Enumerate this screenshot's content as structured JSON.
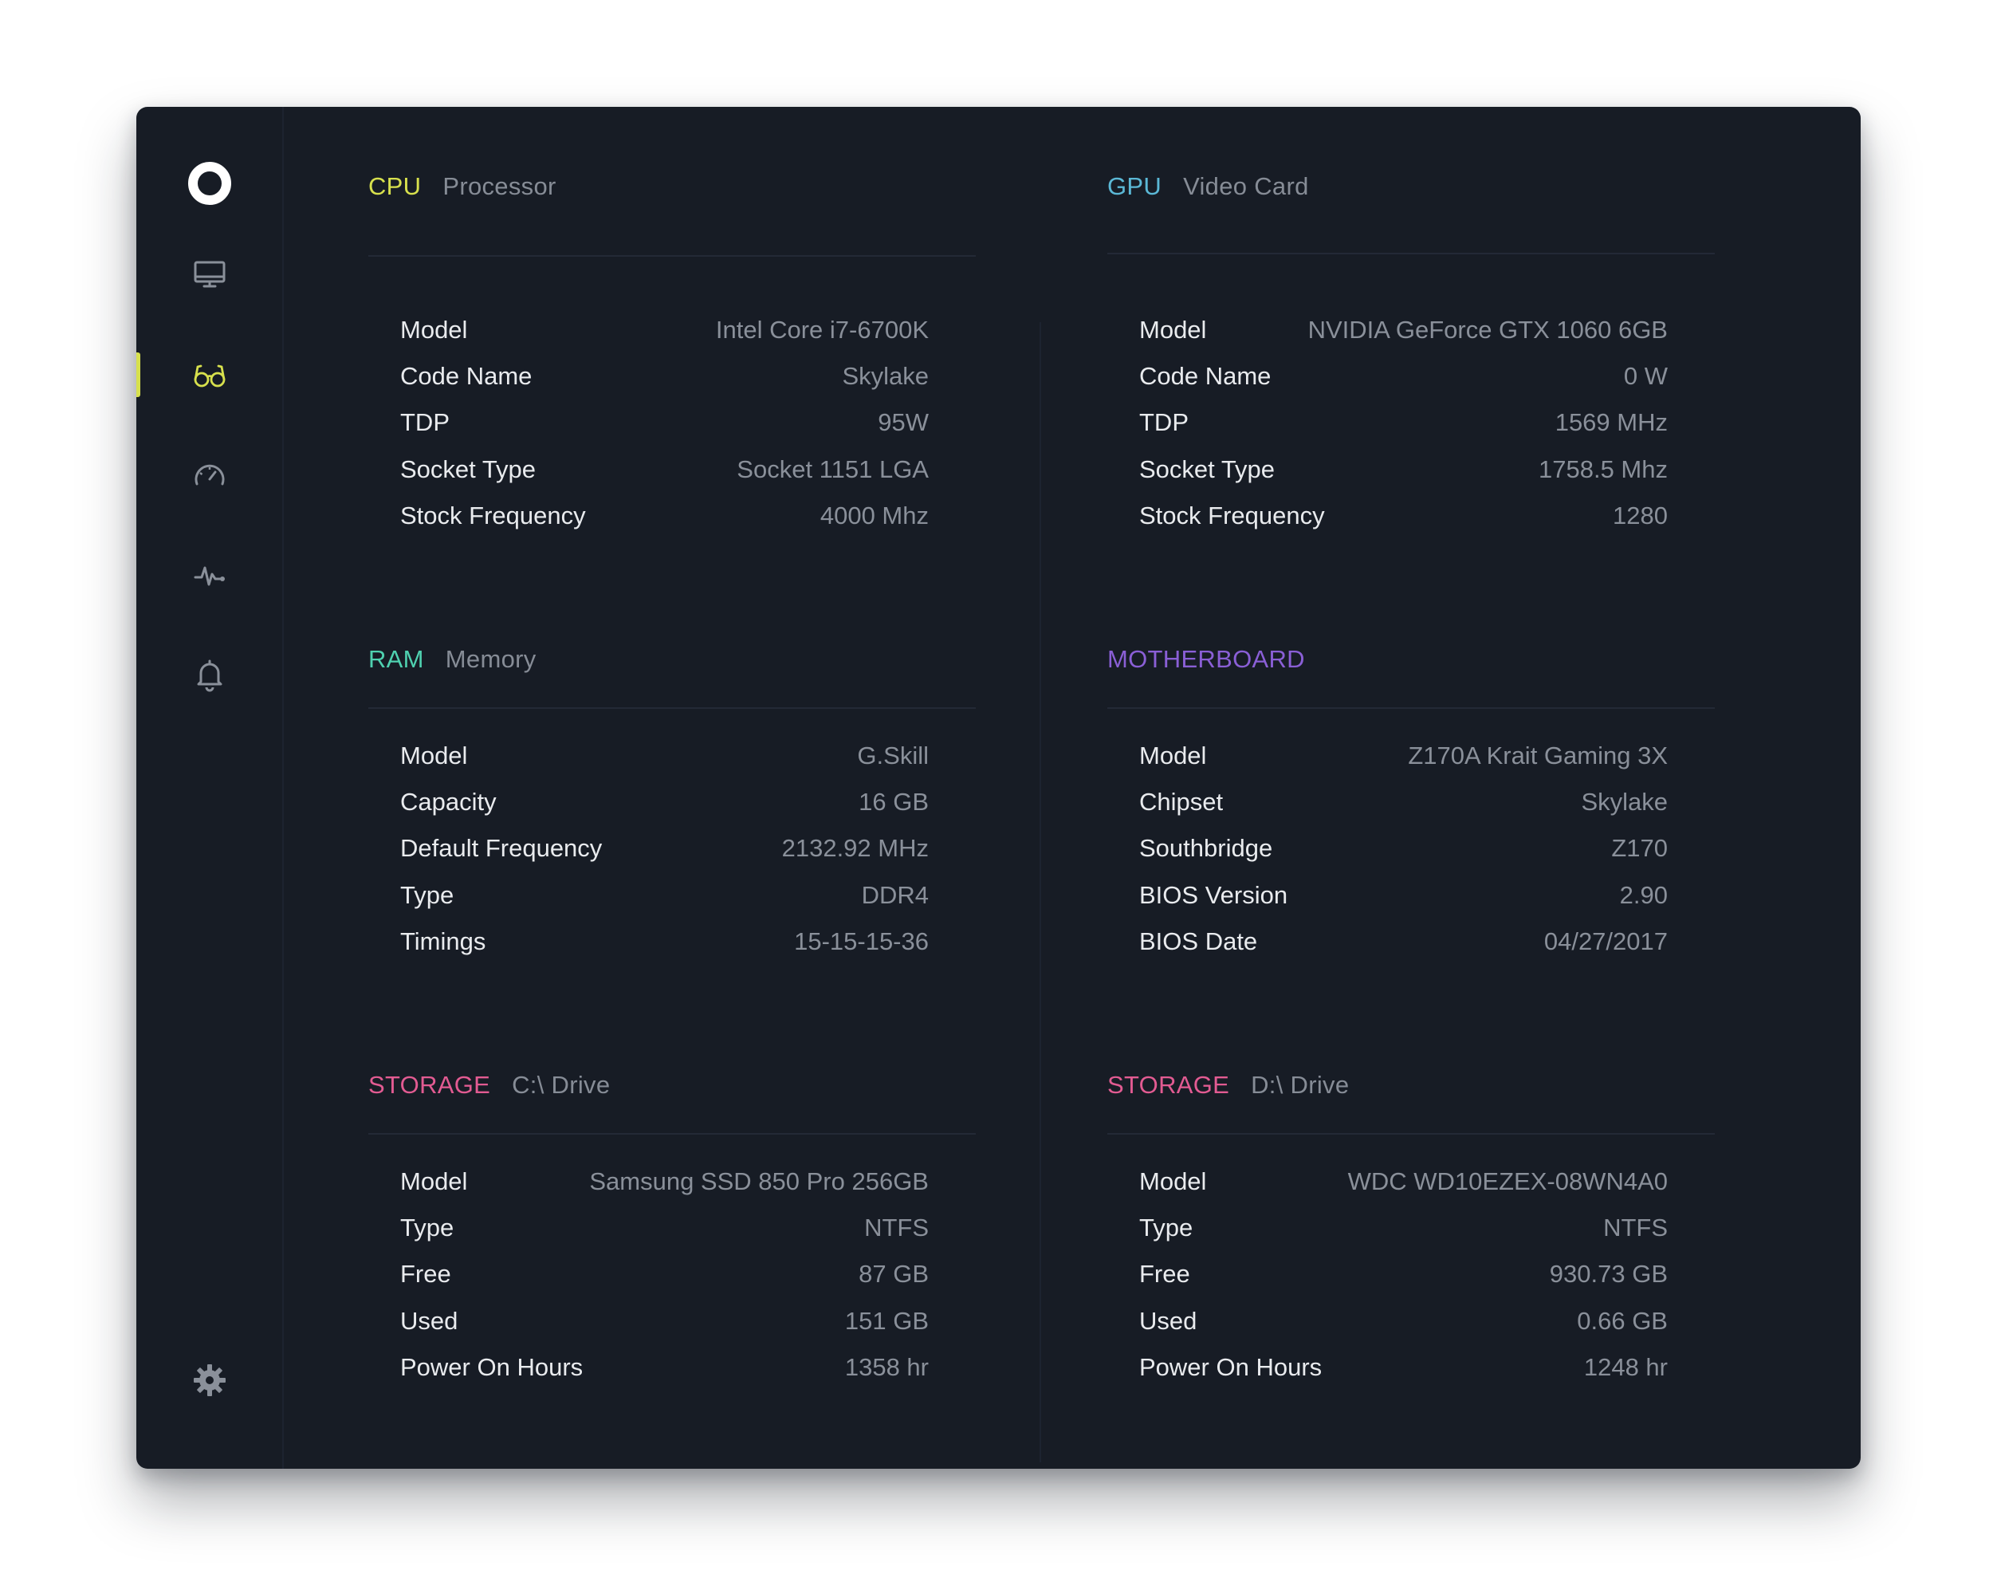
{
  "colors": {
    "window_bg": "#171c25",
    "accent_active": "#d7e04d",
    "cpu": "#d7e04d",
    "gpu": "#5bb8d6",
    "ram": "#4fd1b0",
    "motherboard": "#8a5fd6",
    "storage": "#e25b92",
    "label": "#e9ebee",
    "value": "#8a909a"
  },
  "sidebar": {
    "logo": "logo-ring-icon",
    "items": [
      {
        "icon": "monitor-icon",
        "active": false
      },
      {
        "icon": "glasses-icon",
        "active": true
      },
      {
        "icon": "speedometer-icon",
        "active": false
      },
      {
        "icon": "pulse-icon",
        "active": false
      },
      {
        "icon": "bell-icon",
        "active": false
      }
    ],
    "settings_icon": "gear-icon"
  },
  "panels": {
    "cpu": {
      "tag": "CPU",
      "subtitle": "Processor",
      "rows": [
        {
          "label": "Model",
          "value": "Intel Core i7-6700K"
        },
        {
          "label": "Code Name",
          "value": "Skylake"
        },
        {
          "label": "TDP",
          "value": "95W"
        },
        {
          "label": "Socket Type",
          "value": "Socket 1151 LGA"
        },
        {
          "label": "Stock Frequency",
          "value": "4000 Mhz"
        }
      ]
    },
    "gpu": {
      "tag": "GPU",
      "subtitle": "Video Card",
      "rows": [
        {
          "label": "Model",
          "value": "NVIDIA GeForce GTX 1060 6GB"
        },
        {
          "label": "Code Name",
          "value": "0 W"
        },
        {
          "label": "TDP",
          "value": "1569 MHz"
        },
        {
          "label": "Socket Type",
          "value": "1758.5 Mhz"
        },
        {
          "label": "Stock Frequency",
          "value": "1280"
        }
      ]
    },
    "ram": {
      "tag": "RAM",
      "subtitle": "Memory",
      "rows": [
        {
          "label": "Model",
          "value": "G.Skill"
        },
        {
          "label": "Capacity",
          "value": "16 GB"
        },
        {
          "label": "Default Frequency",
          "value": "2132.92 MHz"
        },
        {
          "label": "Type",
          "value": "DDR4"
        },
        {
          "label": "Timings",
          "value": "15-15-15-36"
        }
      ]
    },
    "motherboard": {
      "tag": "MOTHERBOARD",
      "subtitle": "",
      "rows": [
        {
          "label": "Model",
          "value": "Z170A Krait Gaming 3X"
        },
        {
          "label": "Chipset",
          "value": "Skylake"
        },
        {
          "label": "Southbridge",
          "value": "Z170"
        },
        {
          "label": "BIOS Version",
          "value": "2.90"
        },
        {
          "label": "BIOS Date",
          "value": "04/27/2017"
        }
      ]
    },
    "storage_c": {
      "tag": "STORAGE",
      "subtitle": "C:\\ Drive",
      "rows": [
        {
          "label": "Model",
          "value": "Samsung SSD 850 Pro 256GB"
        },
        {
          "label": "Type",
          "value": "NTFS"
        },
        {
          "label": "Free",
          "value": "87 GB"
        },
        {
          "label": "Used",
          "value": "151 GB"
        },
        {
          "label": "Power On Hours",
          "value": "1358 hr"
        }
      ]
    },
    "storage_d": {
      "tag": "STORAGE",
      "subtitle": "D:\\ Drive",
      "rows": [
        {
          "label": "Model",
          "value": "WDC WD10EZEX-08WN4A0"
        },
        {
          "label": "Type",
          "value": "NTFS"
        },
        {
          "label": "Free",
          "value": "930.73 GB"
        },
        {
          "label": "Used",
          "value": "0.66 GB"
        },
        {
          "label": "Power On Hours",
          "value": "1248 hr"
        }
      ]
    }
  }
}
